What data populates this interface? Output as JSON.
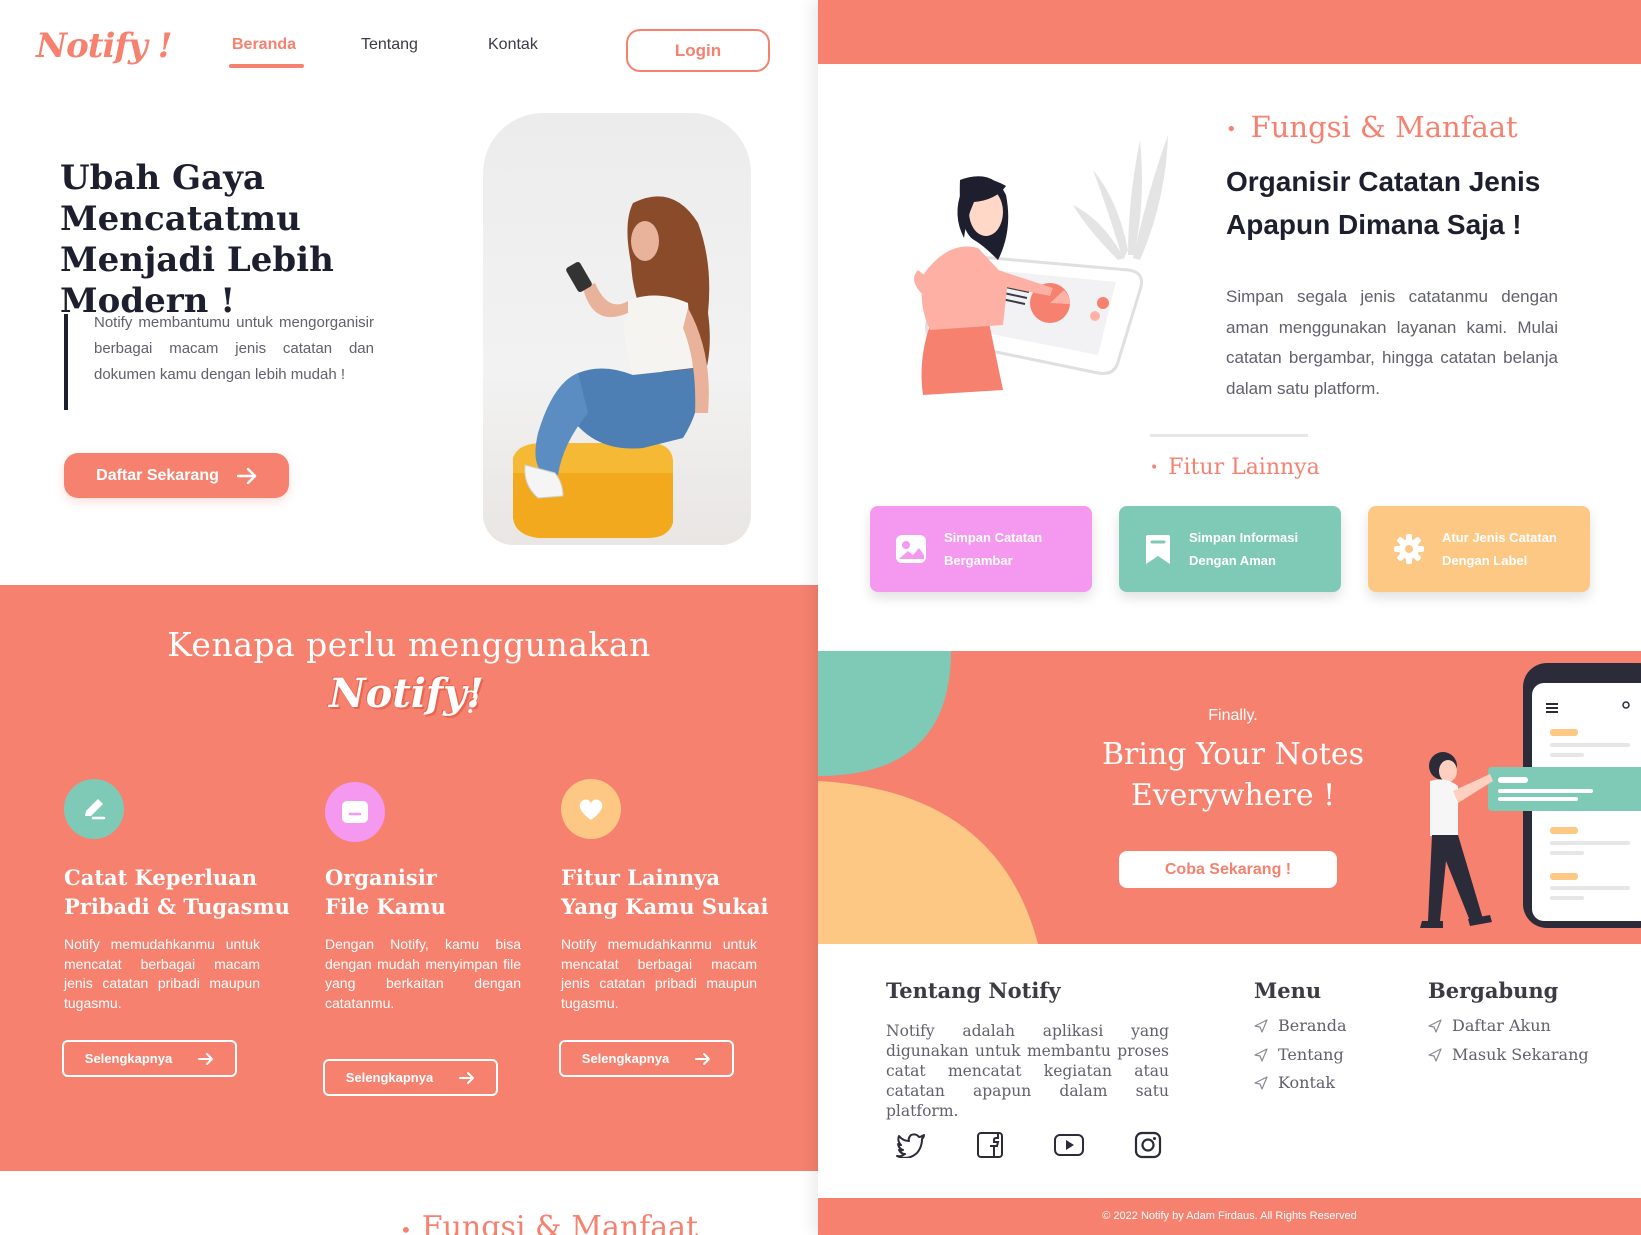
{
  "colors": {
    "accent": "#f6816f",
    "dark": "#1d1f2e",
    "green": "#7ecab7",
    "pink": "#f498f0",
    "orange": "#fdc884",
    "yellow": "#ffd47e"
  },
  "left": {
    "logo": "Notify !",
    "nav": {
      "beranda": "Beranda",
      "tentang": "Tentang",
      "kontak": "Kontak",
      "login": "Login"
    },
    "hero": {
      "title": "Ubah Gaya Mencatatmu Menjadi Lebih Modern !",
      "desc": "Notify membantumu untuk mengorganisir berbagai macam jenis catatan dan dokumen kamu dengan lebih mudah !",
      "cta": "Daftar Sekarang"
    },
    "why": {
      "title": "Kenapa perlu menggunakan",
      "logo": "Notify!",
      "q": "?",
      "features": [
        {
          "title_1": "Catat Keperluan",
          "title_2": "Pribadi & Tugasmu",
          "desc": "Notify memudahkanmu untuk mencatat berbagai macam jenis catatan pribadi maupun tugasmu.",
          "button": "Selengkapnya",
          "icon": "pencil-icon"
        },
        {
          "title_1": "Organisir",
          "title_2": "File Kamu",
          "desc": "Dengan Notify, kamu bisa dengan mudah menyimpan file yang berkaitan dengan catatanmu.",
          "button": "Selengkapnya",
          "icon": "folder-icon"
        },
        {
          "title_1": "Fitur Lainnya",
          "title_2": "Yang Kamu Sukai",
          "desc": "Notify memudahkanmu untuk mencatat berbagai macam jenis catatan pribadi maupun tugasmu.",
          "button": "Selengkapnya",
          "icon": "heart-icon"
        }
      ]
    },
    "peek_title": "Fungsi & Manfaat"
  },
  "right": {
    "fm_label": "Fungsi & Manfaat",
    "fm_title": "Organisir Catatan Jenis Apapun  Dimana Saja !",
    "fm_desc": "Simpan segala jenis catatanmu dengan aman menggunakan layanan kami. Mulai catatan bergambar, hingga catatan belanja dalam satu platform.",
    "fl_label": "Fitur Lainnya",
    "cards": [
      {
        "text": "Simpan Catatan Bergambar",
        "icon": "image-icon"
      },
      {
        "text": "Simpan Informasi Dengan Aman",
        "icon": "bookmark-icon"
      },
      {
        "text": "Atur Jenis Catatan Dengan Label",
        "icon": "gear-icon"
      }
    ],
    "promo": {
      "small": "Finally.",
      "title": "Bring Your Notes Everywhere !",
      "button": "Coba Sekarang !"
    },
    "footer": {
      "about_title": "Tentang Notify",
      "about_desc": "Notify adalah aplikasi yang digunakan untuk membantu proses catat mencatat kegiatan atau catatan apapun dalam satu platform.",
      "menu_title": "Menu",
      "menu": [
        "Beranda",
        "Tentang",
        "Kontak"
      ],
      "join_title": "Bergabung",
      "join": [
        "Daftar Akun",
        "Masuk Sekarang"
      ],
      "social": [
        "twitter-icon",
        "facebook-icon",
        "youtube-icon",
        "instagram-icon"
      ],
      "copyright": "© 2022 Notify by Adam Firdaus. All Rights Reserved"
    }
  }
}
